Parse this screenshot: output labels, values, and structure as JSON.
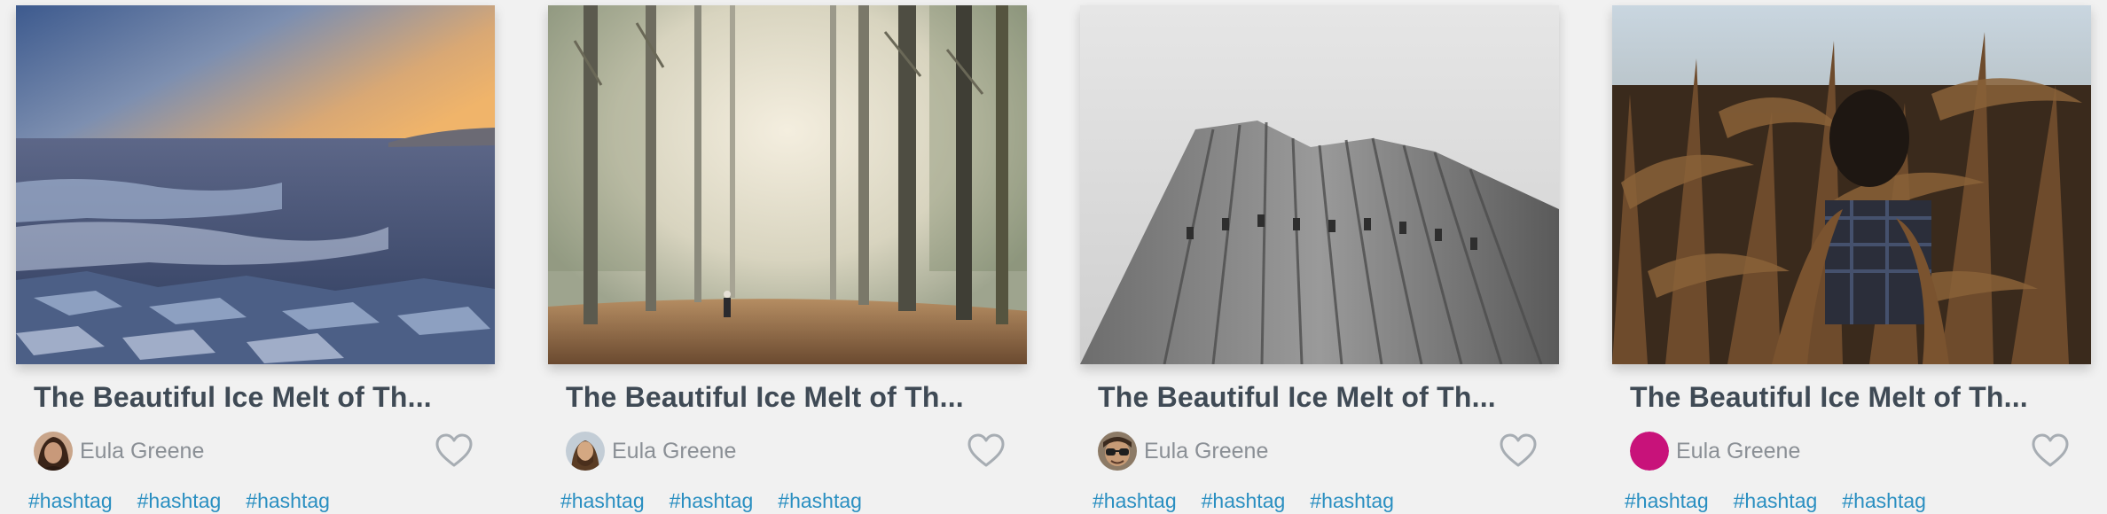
{
  "cards": [
    {
      "title": "The Beautiful Ice Melt of Th...",
      "image": "frozen-lake-sunset-photo",
      "author": {
        "name": "Eula Greene",
        "avatar": "avatar-dark-hair-photo"
      },
      "like_icon": "heart-outline-icon",
      "tags": [
        "#hashtag",
        "#hashtag",
        "#hashtag"
      ]
    },
    {
      "title": "The Beautiful Ice Melt of Th...",
      "image": "misty-forest-path-photo",
      "author": {
        "name": "Eula Greene",
        "avatar": "avatar-beard-photo"
      },
      "like_icon": "heart-outline-icon",
      "tags": [
        "#hashtag",
        "#hashtag",
        "#hashtag"
      ]
    },
    {
      "title": "The Beautiful Ice Melt of Th...",
      "image": "skyscraper-looking-up-photo",
      "author": {
        "name": "Eula Greene",
        "avatar": "avatar-sunglasses-photo"
      },
      "like_icon": "heart-outline-icon",
      "tags": [
        "#hashtag",
        "#hashtag",
        "#hashtag"
      ]
    },
    {
      "title": "The Beautiful Ice Melt of Th...",
      "image": "cornfield-person-photo",
      "author": {
        "name": "Eula Greene",
        "avatar": "avatar-magenta-circle"
      },
      "like_icon": "heart-outline-icon",
      "tags": [
        "#hashtag",
        "#hashtag",
        "#hashtag"
      ]
    }
  ],
  "colors": {
    "background": "#f1f1f1",
    "title": "#3f4a55",
    "author": "#8a8f95",
    "hashtag": "#2a8fc1",
    "heart": "#a7adb3",
    "avatar_magenta": "#c8127a"
  }
}
